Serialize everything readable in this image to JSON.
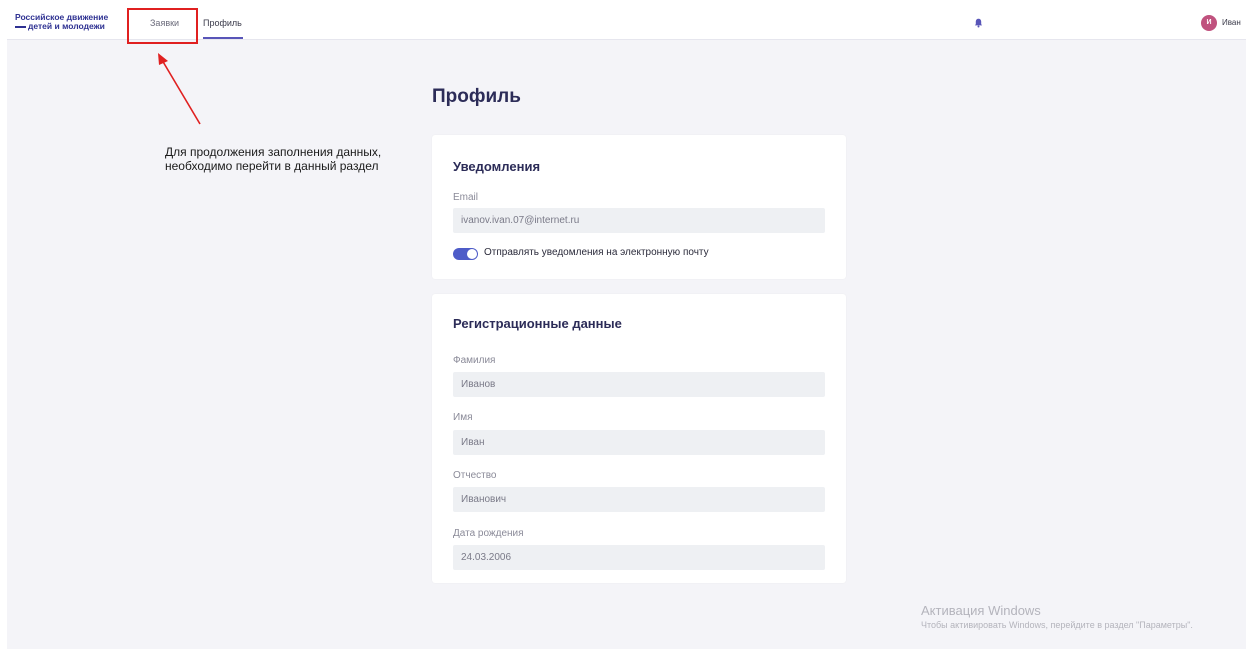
{
  "header": {
    "logo_line1": "Российское движение",
    "logo_line2": "детей и молодежи",
    "nav": [
      {
        "label": "Заявки"
      },
      {
        "label": "Профиль"
      }
    ],
    "avatar_initial": "И",
    "user_name": "Иван"
  },
  "annotation": {
    "text": "Для продолжения заполнения данных, необходимо перейти в данный раздел",
    "color": "#e02020"
  },
  "page": {
    "title": "Профиль"
  },
  "notifications": {
    "heading": "Уведомления",
    "email_label": "Email",
    "email_value": "ivanov.ivan.07@internet.ru",
    "toggle_label": "Отправлять уведомления на электронную почту",
    "toggle_on": true
  },
  "registration": {
    "heading": "Регистрационные данные",
    "fields": [
      {
        "label": "Фамилия",
        "value": "Иванов"
      },
      {
        "label": "Имя",
        "value": "Иван"
      },
      {
        "label": "Отчество",
        "value": "Иванович"
      },
      {
        "label": "Дата рождения",
        "value": "24.03.2006"
      }
    ]
  },
  "watermark": {
    "line1": "Активация Windows",
    "line2": "Чтобы активировать Windows, перейдите в раздел \"Параметры\"."
  },
  "colors": {
    "accent": "#5855b8",
    "avatar": "#c0527e",
    "background": "#f4f4f8"
  }
}
